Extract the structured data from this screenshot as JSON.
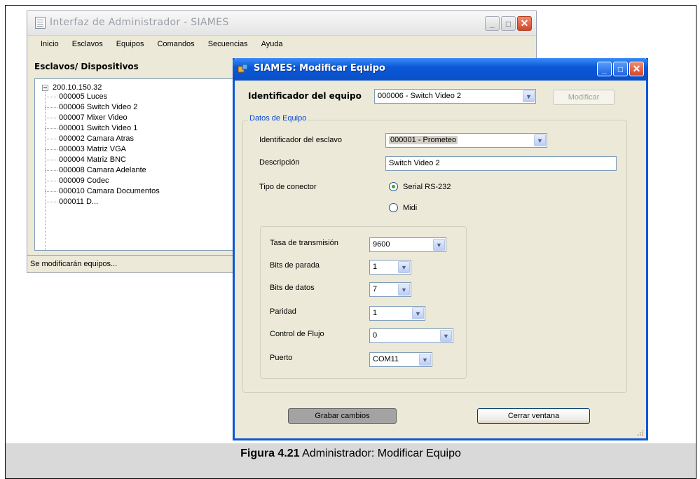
{
  "main_window": {
    "title": "Interfaz de Administrador - SIAMES",
    "menu": [
      "Inicio",
      "Esclavos",
      "Equipos",
      "Comandos",
      "Secuencias",
      "Ayuda"
    ],
    "pane_title": "Esclavos/ Dispositivos",
    "tree_root": "200.10.150.32",
    "tree_items": [
      "000005 Luces",
      "000006 Switch Video 2",
      "000007 Mixer Video",
      "000001 Switch Video 1",
      "000002 Camara Atras",
      "000003 Matriz VGA",
      "000004 Matriz BNC",
      "000008 Camara Adelante",
      "000009 Codec",
      "000010 Camara Documentos",
      "000011 D..."
    ],
    "status": "Se modificarán equipos..."
  },
  "dialog": {
    "title": "SIAMES: Modificar Equipo",
    "id_label": "Identificador del equipo",
    "id_value": "000006 - Switch Video 2",
    "modify_button": "Modificar",
    "group_title": "Datos de Equipo",
    "slave_label": "Identificador del esclavo",
    "slave_value": "000001 - Prometeo",
    "desc_label": "Descripción",
    "desc_value": "Switch Video 2",
    "connector_label": "Tipo de conector",
    "connector_options": [
      "Serial RS-232",
      "Midi"
    ],
    "connector_selected": "Serial RS-232",
    "serial": {
      "baud_label": "Tasa de transmisión",
      "baud_value": "9600",
      "stop_label": "Bits de parada",
      "stop_value": "1",
      "data_label": "Bits de datos",
      "data_value": "7",
      "parity_label": "Paridad",
      "parity_value": "1",
      "flow_label": "Control de Flujo",
      "flow_value": "0",
      "port_label": "Puerto",
      "port_value": "COM11"
    },
    "save_button": "Grabar cambios",
    "close_button": "Cerrar ventana"
  },
  "caption": {
    "label": "Figura 4.21",
    "text": " Administrador: Modificar Equipo"
  },
  "icons": [
    "app-document-icon",
    "minimize-icon",
    "maximize-icon",
    "close-icon",
    "siames-app-icon",
    "tree-collapse-icon",
    "dropdown-arrow-icon",
    "radio-icon",
    "resize-grip-icon"
  ]
}
